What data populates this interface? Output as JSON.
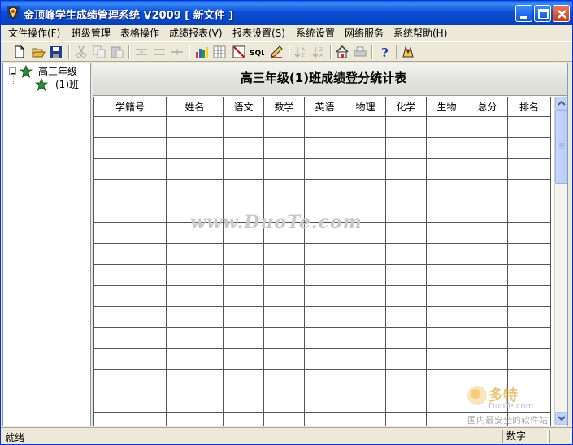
{
  "window": {
    "title": "金顶峰学生成绩管理系统  V2009 [ 新文件 ]"
  },
  "menu": {
    "items": [
      {
        "label": "文件操作(F)"
      },
      {
        "label": "班级管理"
      },
      {
        "label": "表格操作"
      },
      {
        "label": "成绩报表(V)"
      },
      {
        "label": "报表设置(S)"
      },
      {
        "label": "系统设置"
      },
      {
        "label": "网络服务"
      },
      {
        "label": "系统帮助(H)"
      }
    ]
  },
  "tree": {
    "root_label": "高三年级",
    "child_label": "(1)班",
    "root_expander": "−"
  },
  "sheet": {
    "title": "高三年级(1)班成绩登分统计表",
    "columns": [
      "学籍号",
      "姓名",
      "语文",
      "数学",
      "英语",
      "物理",
      "化学",
      "生物",
      "总分",
      "排名"
    ]
  },
  "watermark": {
    "text": "www.DuoTe.com",
    "logo_line1": "多特",
    "logo_line2": "DuoTe.com",
    "logo_line3": "国内最安全的软件站"
  },
  "status": {
    "left": "就绪",
    "panel": "数字"
  }
}
